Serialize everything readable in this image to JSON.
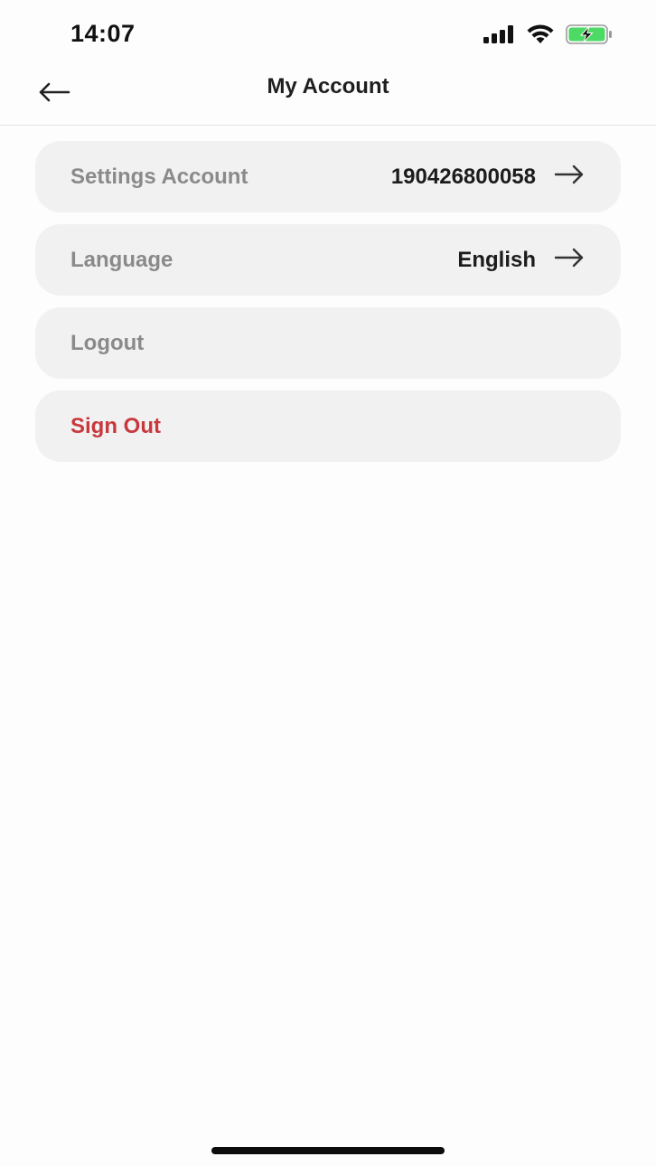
{
  "status_bar": {
    "time": "14:07",
    "icons": [
      "cellular-signal-icon",
      "wifi-icon",
      "battery-charging-icon"
    ],
    "battery_color": "#4cd964"
  },
  "header": {
    "title": "My Account",
    "back_icon": "arrow-left-icon"
  },
  "menu": {
    "items": [
      {
        "label": "Settings Account",
        "value": "190426800058",
        "icon": "arrow-right-icon"
      },
      {
        "label": "Language",
        "value": "English",
        "icon": "arrow-right-icon"
      },
      {
        "label": "Logout"
      },
      {
        "label": "Sign Out",
        "color": "#c8383c"
      }
    ]
  }
}
